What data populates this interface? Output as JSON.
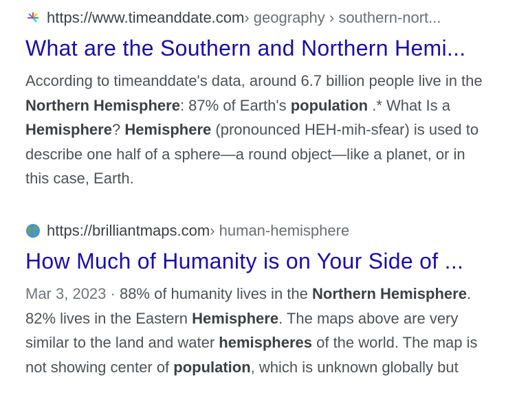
{
  "results": [
    {
      "url_domain": "https://www.timeanddate.com",
      "url_path": " › geography › southern-nort...",
      "title": "What are the Southern and Northern Hemi...",
      "snippet": [
        {
          "t": "According to timeanddate's data, around 6.7 billion people live in the ",
          "b": false
        },
        {
          "t": "Northern Hemisphere",
          "b": true
        },
        {
          "t": ": 87% of Earth's ",
          "b": false
        },
        {
          "t": "population",
          "b": true
        },
        {
          "t": " .* What Is a ",
          "b": false
        },
        {
          "t": "Hemisphere",
          "b": true
        },
        {
          "t": "? ",
          "b": false
        },
        {
          "t": "Hemisphere",
          "b": true
        },
        {
          "t": " (pronounced HEH-mih-sfear) is used to describe one half of a sphere—a round object—like a planet, or in this case, Earth.",
          "b": false
        }
      ]
    },
    {
      "url_domain": "https://brilliantmaps.com",
      "url_path": " › human-hemisphere",
      "title": "How Much of Humanity is on Your Side of ...",
      "date": "Mar 3, 2023 · ",
      "snippet": [
        {
          "t": "88% of humanity lives in the ",
          "b": false
        },
        {
          "t": "Northern Hemisphere",
          "b": true
        },
        {
          "t": ". 82% lives in the Eastern ",
          "b": false
        },
        {
          "t": "Hemisphere",
          "b": true
        },
        {
          "t": ". The maps above are very similar to the land and water ",
          "b": false
        },
        {
          "t": "hemispheres",
          "b": true
        },
        {
          "t": " of the world. The map is not showing center of ",
          "b": false
        },
        {
          "t": "population",
          "b": true
        },
        {
          "t": ", which is unknown globally but thought to be somewhere north of South",
          "b": false
        }
      ]
    }
  ],
  "colors": {
    "title_link": "#1a0dab",
    "snippet_text": "#4d5156",
    "url_path": "#6b6f73"
  },
  "icons": [
    "timeanddate-favicon",
    "globe-icon"
  ]
}
